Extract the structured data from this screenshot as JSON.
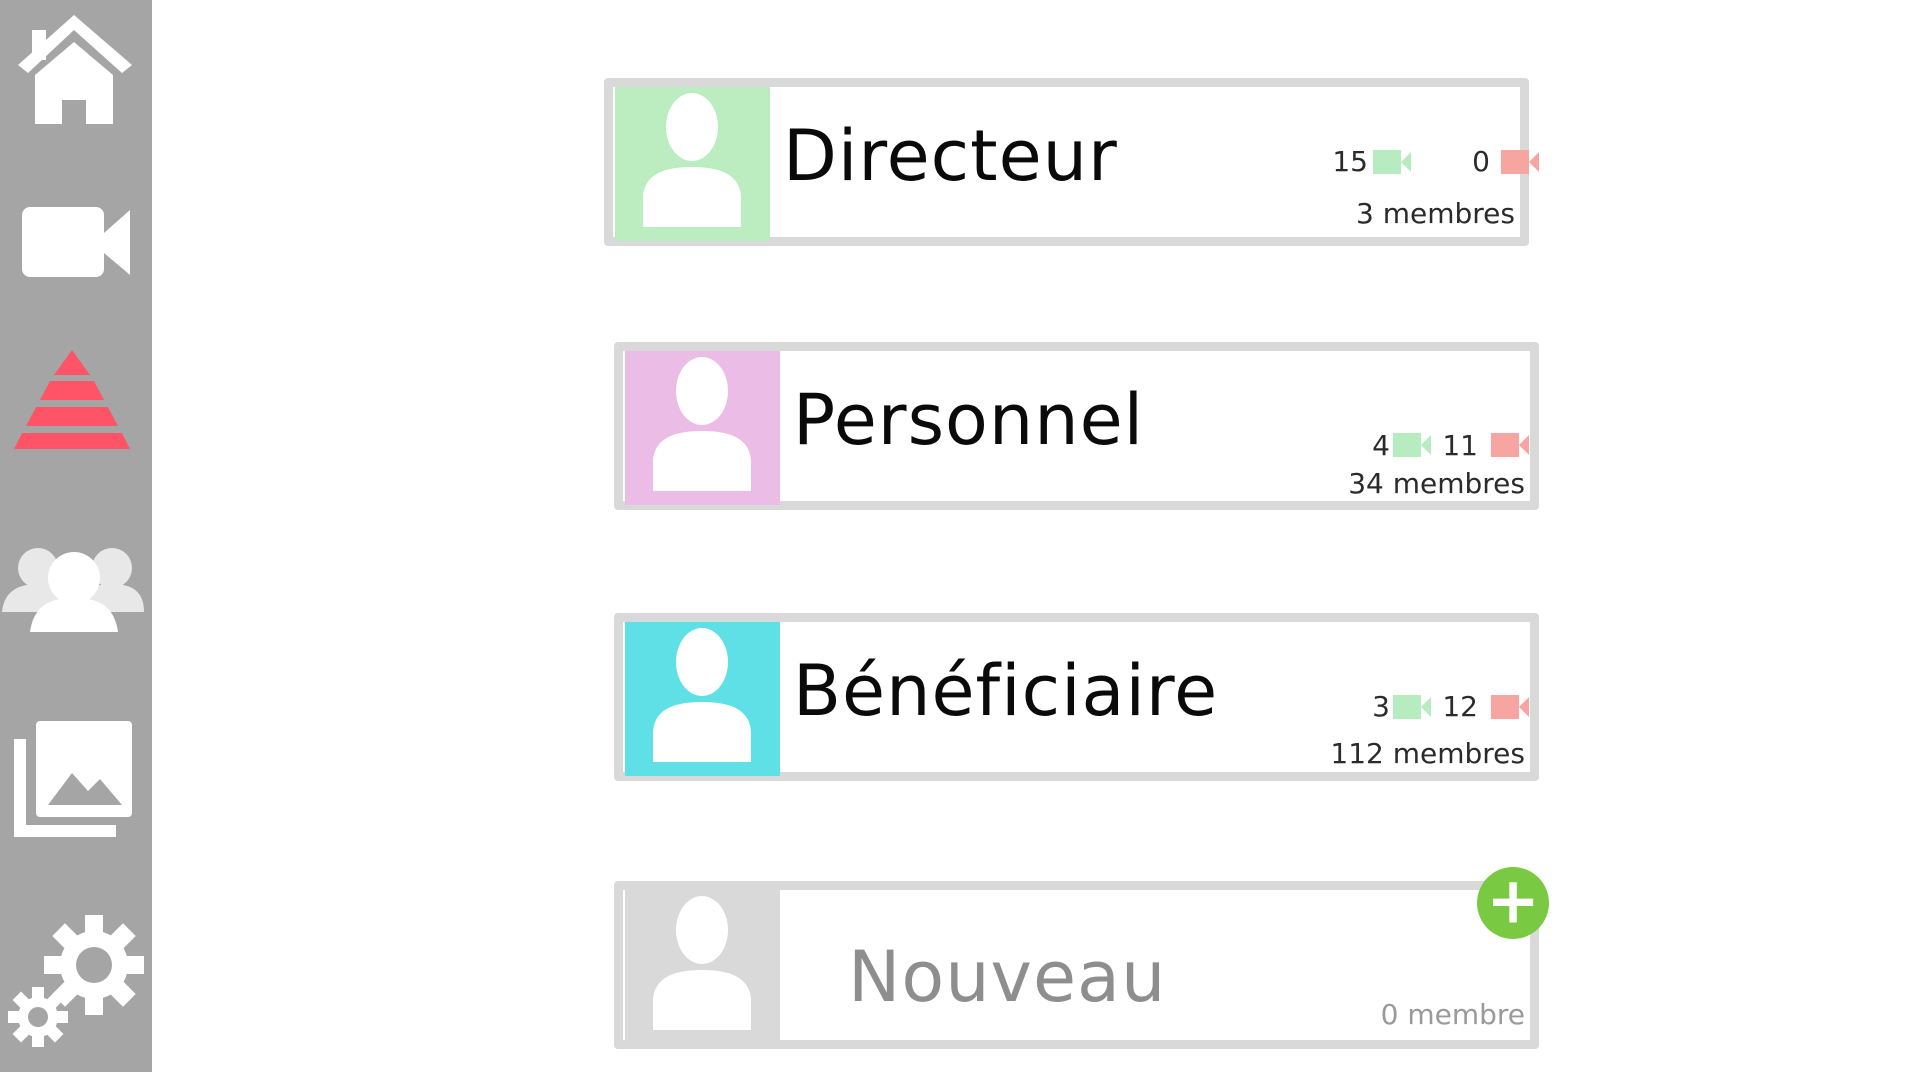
{
  "sidebar": {
    "items": [
      {
        "name": "home-icon"
      },
      {
        "name": "video-camera-icon"
      },
      {
        "name": "hierarchy-pyramid-icon"
      },
      {
        "name": "group-users-icon"
      },
      {
        "name": "gallery-icon"
      },
      {
        "name": "settings-gears-icon"
      }
    ]
  },
  "groups": [
    {
      "name": "Directeur",
      "camera_active": "15",
      "camera_inactive": "0",
      "members": "3 membres",
      "color": "#bbedc1"
    },
    {
      "name": "Personnel",
      "camera_active": "4",
      "camera_inactive": "11",
      "members": "34 membres",
      "color": "#ebbde6"
    },
    {
      "name": "Bénéficiaire",
      "camera_active": "3",
      "camera_inactive": "12",
      "members": "112 membres",
      "color": "#5ee0e6"
    }
  ],
  "new_group": {
    "name": "Nouveau",
    "members": "0 membre",
    "add_label": "+",
    "color": "#d9d9d9"
  },
  "colors": {
    "sidebar": "#a5a5a5",
    "camera_green": "#b6ecbf",
    "camera_red": "#f6a5a1",
    "pyramid": "#ff5468",
    "add_green": "#7ac943"
  }
}
